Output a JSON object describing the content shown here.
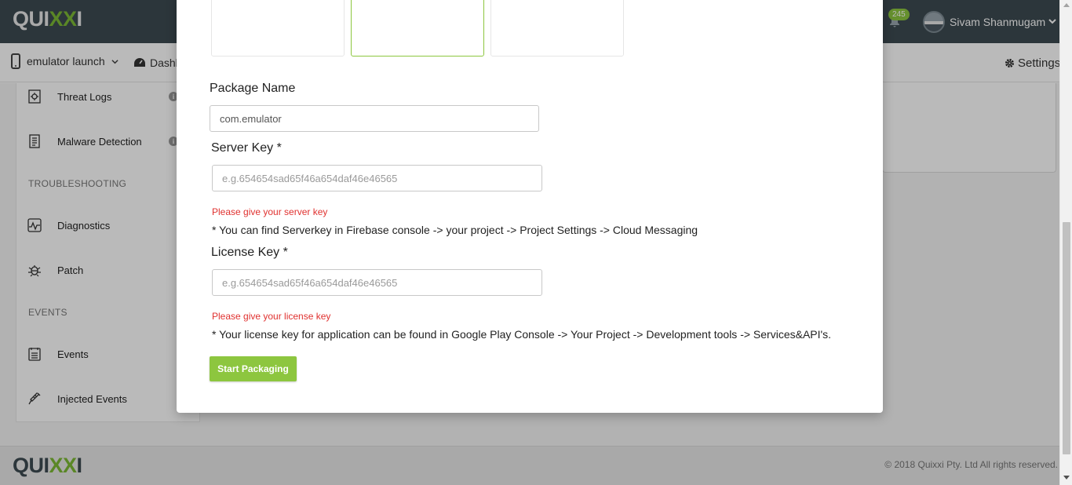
{
  "header": {
    "logo": {
      "pre": "QUI",
      "mark": "XX",
      "post": "I"
    },
    "notifications_count": "245",
    "user_name": "Sivam Shanmugam",
    "bell_icon": "bell-icon",
    "chevron_icon": "chevron-down-icon"
  },
  "subnav": {
    "device_name": "emulator launch",
    "dashboard_label": "Dashb",
    "settings_label": "Settings"
  },
  "sidebar": {
    "items": [
      {
        "label": "Threat Logs",
        "icon": "threat-log-icon",
        "has_info": true
      },
      {
        "label": "Malware Detection",
        "icon": "document-icon",
        "has_info": true
      },
      {
        "label": "Diagnostics",
        "icon": "pulse-icon",
        "has_info": false
      },
      {
        "label": "Patch",
        "icon": "bug-icon",
        "has_info": false
      },
      {
        "label": "Events",
        "icon": "calendar-list-icon",
        "has_info": false
      },
      {
        "label": "Injected Events",
        "icon": "syringe-icon",
        "has_info": false
      }
    ],
    "sections": {
      "troubleshooting": "TROUBLESHOOTING",
      "events": "EVENTS"
    },
    "info_glyph": "i"
  },
  "modal": {
    "package_name": {
      "label": "Package Name",
      "value": "com.emulator"
    },
    "server_key": {
      "label": "Server Key *",
      "placeholder": "e.g.654654sad65f46a654daf46e46565",
      "error": "Please give your server key",
      "hint": "* You can find Serverkey in Firebase console -> your project -> Project Settings -> Cloud Messaging"
    },
    "license_key": {
      "label": "License Key *",
      "placeholder": "e.g.654654sad65f46a654daf46e46565",
      "error": "Please give your license key",
      "hint": "* Your license key for application can be found in Google Play Console -> Your Project -> Development tools -> Services&API's."
    },
    "submit_label": "Start Packaging"
  },
  "footer": {
    "logo": {
      "pre": "QUI",
      "mark": "XX",
      "post": "I"
    },
    "copyright": "© 2018 Quixxi Pty. Ltd All rights reserved."
  },
  "colors": {
    "brand_green": "#8dc63f",
    "header_bg": "#3d4a51",
    "error_red": "#e0312f"
  }
}
